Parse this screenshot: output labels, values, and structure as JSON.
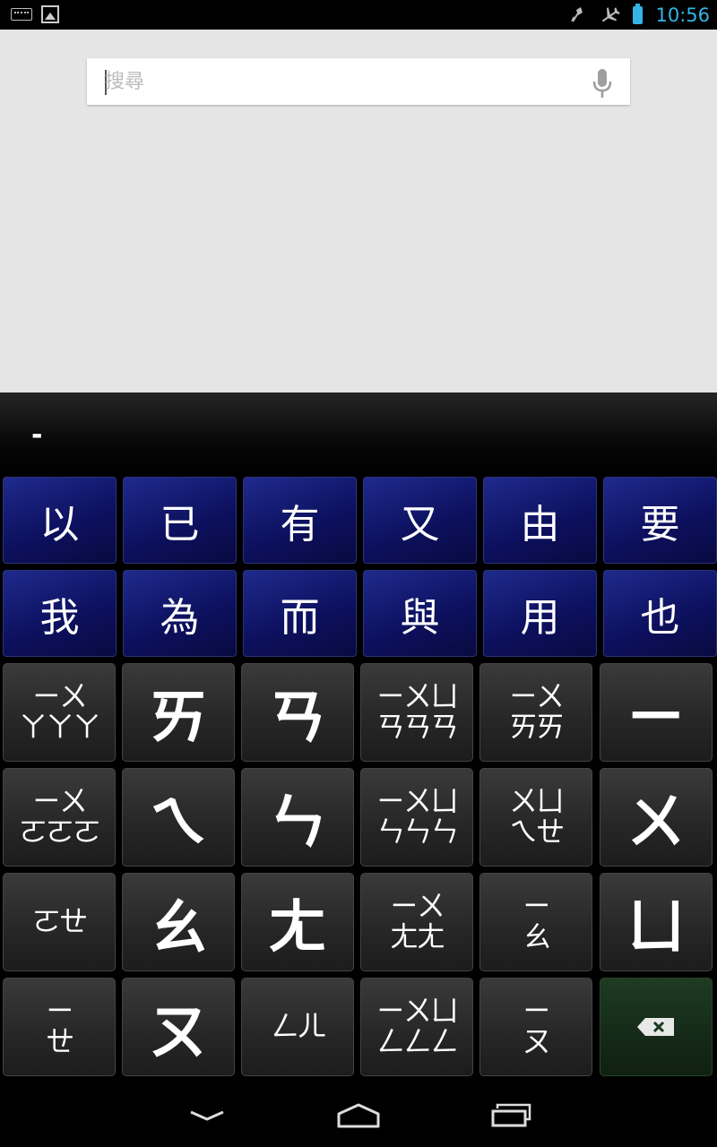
{
  "status": {
    "time": "10:56",
    "left_icons": [
      "keyboard-icon",
      "image-icon"
    ],
    "right_icons": [
      "vibrate-off-icon",
      "airplane-mode-icon",
      "battery-icon"
    ],
    "battery_color": "#33b5e5"
  },
  "search": {
    "placeholder": "搜尋",
    "value": ""
  },
  "keyboard": {
    "composing_text": "-",
    "candidates_row1": [
      "以",
      "已",
      "有",
      "又",
      "由",
      "要"
    ],
    "candidates_row2": [
      "我",
      "為",
      "而",
      "與",
      "用",
      "也"
    ],
    "keys": [
      [
        "ㄧㄨ\nㄚㄚㄚ",
        "ㄞ",
        "ㄢ",
        "ㄧㄨㄩ\nㄢㄢㄢ",
        "ㄧㄨ\nㄞㄞ",
        "ㄧ"
      ],
      [
        "ㄧㄨ\nㄛㄛㄛ",
        "ㄟ",
        "ㄣ",
        "ㄧㄨㄩ\nㄣㄣㄣ",
        "ㄨㄩ\nㄟㄝ",
        "ㄨ"
      ],
      [
        "ㄛㄝ",
        "ㄠ",
        "ㄤ",
        "ㄧㄨ\nㄤㄤ",
        "ㄧ\nㄠ",
        "ㄩ"
      ],
      [
        "ㄧ\nㄝ",
        "ㄡ",
        "ㄥㄦ",
        "ㄧㄨㄩ\nㄥㄥㄥ",
        "ㄧ\nㄡ",
        "delete"
      ]
    ],
    "candidate_color": "#10157a",
    "delete_key_color": "#163019"
  },
  "nav": {
    "buttons": [
      "back-icon",
      "home-icon",
      "recent-apps-icon"
    ]
  }
}
